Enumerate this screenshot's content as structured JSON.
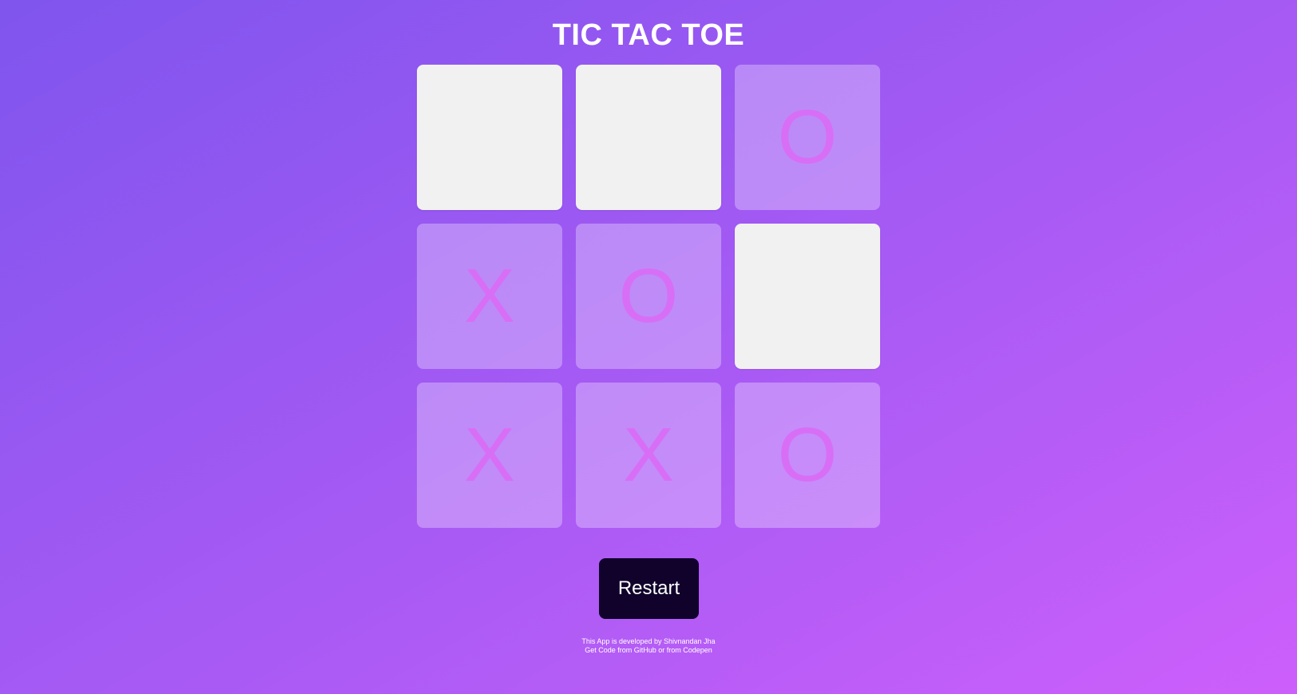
{
  "app": {
    "title": "TIC TAC TOE"
  },
  "board": {
    "cells": [
      {
        "mark": "",
        "state": "empty"
      },
      {
        "mark": "",
        "state": "empty"
      },
      {
        "mark": "O",
        "state": "filled"
      },
      {
        "mark": "X",
        "state": "filled"
      },
      {
        "mark": "O",
        "state": "filled"
      },
      {
        "mark": "",
        "state": "empty"
      },
      {
        "mark": "X",
        "state": "filled"
      },
      {
        "mark": "X",
        "state": "filled"
      },
      {
        "mark": "O",
        "state": "filled"
      }
    ]
  },
  "controls": {
    "restart_label": "Restart"
  },
  "footer": {
    "developer_prefix": "This App is developed by ",
    "developer_name": "Shivnandan Jha",
    "code_prefix": "Get Code from ",
    "github_label": "GitHub",
    "code_middle": " or from ",
    "codepen_label": "Codepen"
  },
  "colors": {
    "background_start": "#7f55ee",
    "background_end": "#cd5ffc",
    "empty_cell": "#f1f1f1",
    "mark": "#d86ef6",
    "restart_button": "#10022b",
    "title_text": "#ffffff"
  }
}
